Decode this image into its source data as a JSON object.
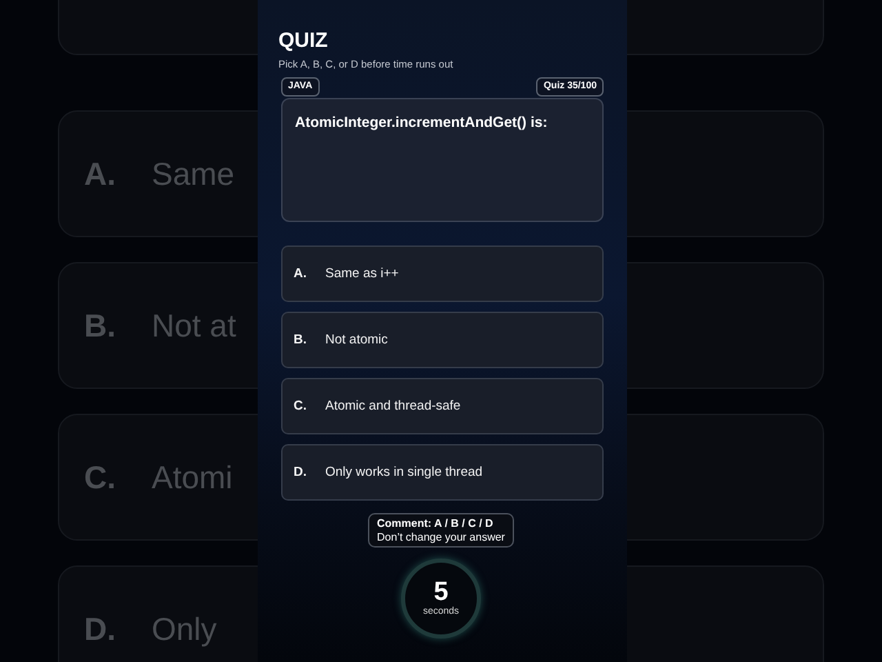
{
  "backdrop": {
    "options": [
      {
        "letter": "A.",
        "text": "Same"
      },
      {
        "letter": "B.",
        "text": "Not at"
      },
      {
        "letter": "C.",
        "text": "Atomi"
      },
      {
        "letter": "D.",
        "text": "Only"
      }
    ]
  },
  "quiz": {
    "title": "QUIZ",
    "subtitle": "Pick A, B, C, or D before time runs out",
    "topic": "JAVA",
    "counter": "Quiz 35/100",
    "question": "AtomicInteger.incrementAndGet() is:",
    "options": [
      {
        "letter": "A.",
        "text": "Same as i++"
      },
      {
        "letter": "B.",
        "text": "Not atomic"
      },
      {
        "letter": "C.",
        "text": "Atomic and thread-safe"
      },
      {
        "letter": "D.",
        "text": "Only works in single thread"
      }
    ],
    "comment": {
      "title": "Comment: A / B / C / D",
      "note": "Don’t change your answer"
    },
    "timer": {
      "value": "5",
      "unit": "seconds"
    }
  }
}
